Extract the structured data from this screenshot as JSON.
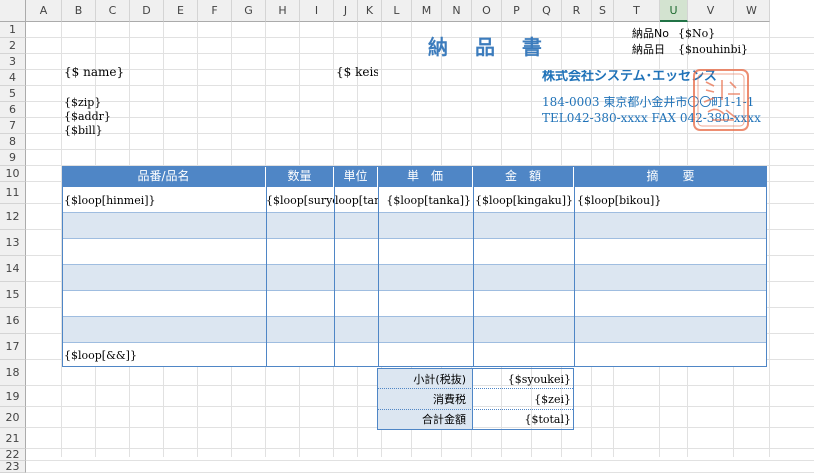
{
  "columns": [
    "A",
    "B",
    "C",
    "D",
    "E",
    "F",
    "G",
    "H",
    "I",
    "J",
    "K",
    "L",
    "M",
    "N",
    "O",
    "P",
    "Q",
    "R",
    "S",
    "T",
    "U",
    "V",
    "W"
  ],
  "active_column": "U",
  "rows": [
    "1",
    "2",
    "3",
    "4",
    "5",
    "6",
    "7",
    "8",
    "9",
    "10",
    "11",
    "12",
    "13",
    "14",
    "15",
    "16",
    "17",
    "18",
    "19",
    "20",
    "21",
    "22",
    "23"
  ],
  "document": {
    "title": "納 品 書",
    "delivery_no_label": "納品No",
    "delivery_no_value": "{$No}",
    "delivery_date_label": "納品日",
    "delivery_date_value": "{$nouhinbi}",
    "name": "{$ name}",
    "keisyo": "{$ keisy",
    "zip": "{$zip}",
    "addr": "{$addr}",
    "bill": "{$bill}"
  },
  "company": {
    "name": "株式会社システム･エッセンス",
    "address": "184-0003  東京都小金井市〇〇町1-1-1",
    "tel": "TEL042-380-xxxx  FAX 042-380-xxxx",
    "stamp_color": "#e8704d"
  },
  "table": {
    "headers": [
      "品番/品名",
      "数量",
      "単位",
      "単　価",
      "金　額",
      "摘　　要"
    ],
    "row12": [
      "{$loop[hinmei]}",
      "{$loop[suryo]}",
      "loop[tani",
      "{$loop[tanka]}",
      "{$loop[kingaku]}",
      "{$loop[bikou]}"
    ],
    "row18": "{$loop[&&]}",
    "header_color": "#4f86c6",
    "band_color": "#dce6f1"
  },
  "summary": {
    "subtotal_label": "小計(税抜)",
    "subtotal_value": "{$syoukei}",
    "tax_label": "消費税",
    "tax_value": "{$zei}",
    "total_label": "合計金額",
    "total_value": "{$total}"
  }
}
